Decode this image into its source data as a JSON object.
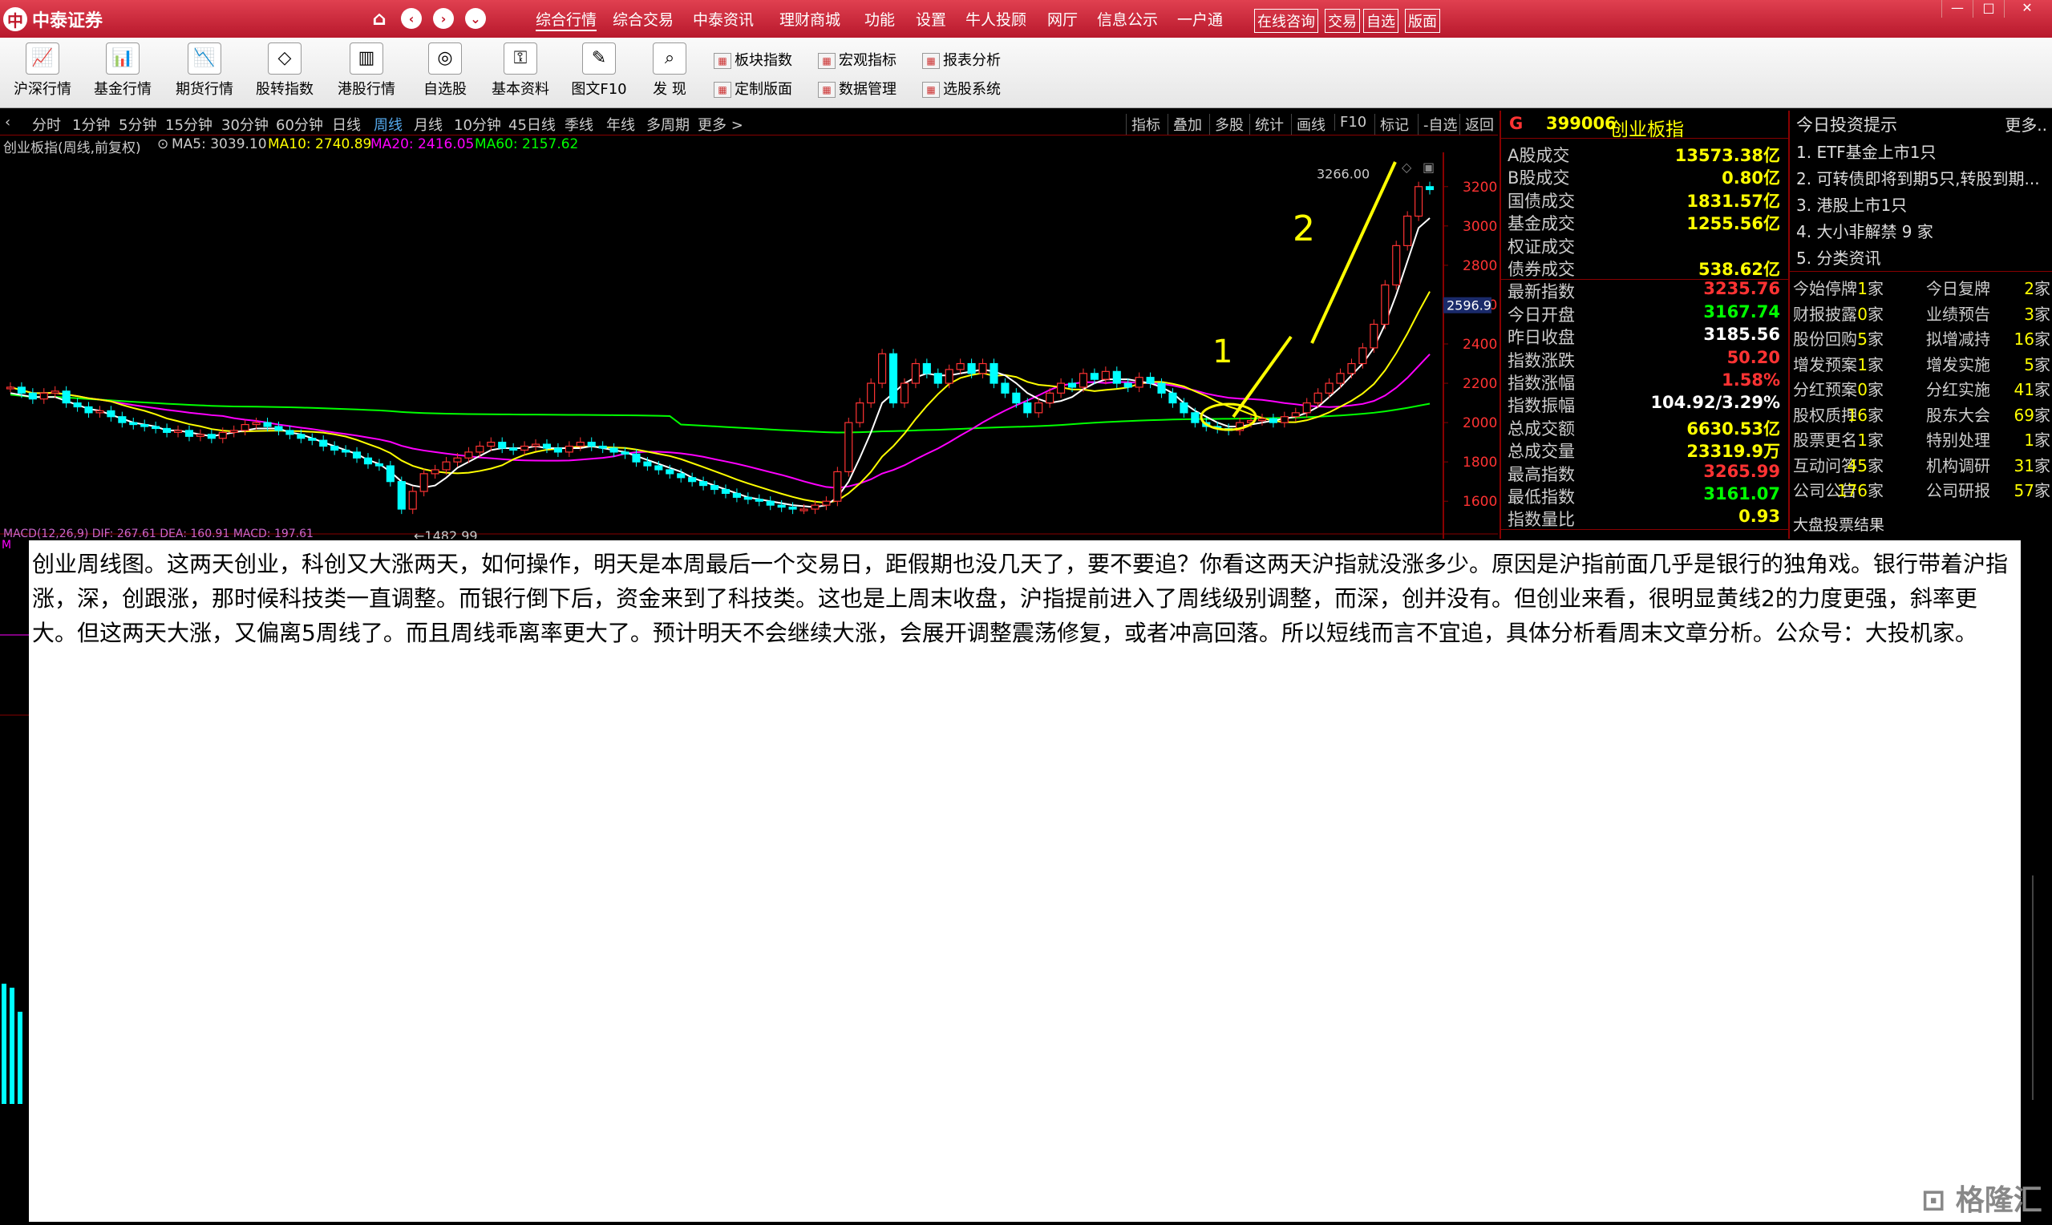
{
  "app": {
    "brand": "中泰证券"
  },
  "menu": {
    "items": [
      "综合行情",
      "综合交易",
      "中泰资讯",
      "理财商城",
      "功能",
      "设置",
      "牛人投顾",
      "网厅",
      "信息公示",
      "一户通"
    ],
    "boxed": [
      "在线咨询",
      "交易",
      "自选",
      "版面"
    ]
  },
  "window_controls": [
    "—",
    "□",
    "✕"
  ],
  "toolbar": {
    "tools": [
      "沪深行情",
      "基金行情",
      "期货行情",
      "股转指数",
      "港股行情",
      "自选股",
      "基本资料",
      "图文F10",
      "发 现"
    ],
    "mini": [
      "板块指数",
      "宏观指标",
      "报表分析",
      "定制版面",
      "数据管理",
      "选股系统"
    ]
  },
  "periods": {
    "items": [
      "分时",
      "1分钟",
      "5分钟",
      "15分钟",
      "30分钟",
      "60分钟",
      "日线",
      "周线",
      "月线",
      "10分钟",
      "45日线",
      "季线",
      "年线",
      "多周期",
      "更多 >"
    ],
    "active": "周线"
  },
  "chart_tools": [
    "指标",
    "叠加",
    "多股",
    "统计",
    "画线",
    "F10",
    "标记",
    "-自选",
    "返回"
  ],
  "chart": {
    "name": "创业板指(周线,前复权)",
    "ma5": "MA5: 3039.10",
    "ma10": "MA10: 2740.89",
    "ma20": "MA20: 2416.05",
    "ma60": "MA60: 2157.62",
    "high_label": "3266.00",
    "low_label": "1482.99",
    "current_marker": "2596.9",
    "handwritten_1": "1",
    "handwritten_2": "2",
    "macd_label": "MACD(12,26,9) DIF: 267.61 DEA: 160.91 MACD: 197.61",
    "colors": {
      "up": "#ff3333",
      "down": "#00ffff",
      "ma5": "#ffffff",
      "ma10": "#ffff00",
      "ma20": "#ff00ff",
      "ma60": "#00ff00",
      "annotation": "#ffff00"
    }
  },
  "chart_data": {
    "type": "candlestick",
    "y_ticks": [
      3200,
      3000,
      2800,
      2600,
      2400,
      2200,
      2000,
      1800,
      1600
    ],
    "ylim": [
      1450,
      3350
    ],
    "annotations": {
      "high": 3266.0,
      "low": 1482.99,
      "current": 2596.9
    },
    "close": [
      2180,
      2150,
      2120,
      2150,
      2160,
      2100,
      2080,
      2050,
      2060,
      2030,
      2000,
      1990,
      1980,
      1970,
      1950,
      1960,
      1930,
      1940,
      1920,
      1950,
      1960,
      1990,
      2000,
      1980,
      1960,
      1940,
      1920,
      1910,
      1880,
      1860,
      1850,
      1820,
      1790,
      1780,
      1700,
      1560,
      1650,
      1740,
      1760,
      1800,
      1820,
      1850,
      1880,
      1900,
      1870,
      1860,
      1880,
      1890,
      1870,
      1850,
      1880,
      1900,
      1880,
      1870,
      1850,
      1840,
      1800,
      1780,
      1760,
      1740,
      1720,
      1700,
      1680,
      1660,
      1640,
      1620,
      1610,
      1600,
      1580,
      1570,
      1560,
      1560,
      1580,
      1600,
      1750,
      2000,
      2100,
      2200,
      2350,
      2100,
      2200,
      2300,
      2250,
      2200,
      2270,
      2300,
      2250,
      2300,
      2200,
      2150,
      2100,
      2050,
      2100,
      2150,
      2200,
      2180,
      2250,
      2220,
      2260,
      2200,
      2180,
      2230,
      2200,
      2150,
      2100,
      2050,
      2000,
      1980,
      1970,
      1960,
      2000,
      2010,
      2020,
      2000,
      2030,
      2050,
      2100,
      2150,
      2200,
      2250,
      2300,
      2380,
      2500,
      2700,
      2900,
      3050,
      3200,
      3185
    ],
    "ma5": [
      2150,
      2140,
      2130,
      2130,
      2130,
      2110,
      2090,
      2070,
      2060,
      2040,
      2020,
      2000,
      1990,
      1980,
      1960,
      1960,
      1950,
      1940,
      1930,
      1940,
      1950,
      1960,
      1970,
      1970,
      1970,
      1950,
      1940,
      1920,
      1900,
      1880,
      1860,
      1840,
      1810,
      1790,
      1750,
      1700,
      1680,
      1670,
      1680,
      1720,
      1770,
      1800,
      1830,
      1860,
      1870,
      1870,
      1870,
      1880,
      1870,
      1870,
      1870,
      1870,
      1880,
      1870,
      1860,
      1850,
      1830,
      1810,
      1790,
      1770,
      1750,
      1720,
      1700,
      1680,
      1660,
      1640,
      1620,
      1610,
      1600,
      1590,
      1580,
      1575,
      1570,
      1580,
      1620,
      1700,
      1820,
      1950,
      2100,
      2150,
      2200,
      2230,
      2250,
      2240,
      2240,
      2250,
      2260,
      2270,
      2260,
      2240,
      2200,
      2150,
      2120,
      2100,
      2110,
      2130,
      2170,
      2200,
      2220,
      2220,
      2220,
      2210,
      2200,
      2180,
      2150,
      2100,
      2060,
      2030,
      2000,
      1980,
      1980,
      1990,
      2000,
      2010,
      2020,
      2030,
      2050,
      2080,
      2130,
      2180,
      2240,
      2300,
      2380,
      2500,
      2650,
      2820,
      2990,
      3040
    ]
  },
  "stock_panel": {
    "flag": "G",
    "code": "399006",
    "name": "创业板指",
    "rows": [
      {
        "label": "A股成交",
        "value": "13573.38亿",
        "color": "#ffff00"
      },
      {
        "label": "B股成交",
        "value": "0.80亿",
        "color": "#ffff00"
      },
      {
        "label": "国债成交",
        "value": "1831.57亿",
        "color": "#ffff00"
      },
      {
        "label": "基金成交",
        "value": "1255.56亿",
        "color": "#ffff00"
      },
      {
        "label": "权证成交",
        "value": "",
        "color": "#ffff00"
      },
      {
        "label": "债券成交",
        "value": "538.62亿",
        "color": "#ffff00"
      },
      {
        "label": "最新指数",
        "value": "3235.76",
        "color": "#ff3333"
      },
      {
        "label": "今日开盘",
        "value": "3167.74",
        "color": "#00ff00"
      },
      {
        "label": "昨日收盘",
        "value": "3185.56",
        "color": "#ffffff"
      },
      {
        "label": "指数涨跌",
        "value": "50.20",
        "color": "#ff3333"
      },
      {
        "label": "指数涨幅",
        "value": "1.58%",
        "color": "#ff3333"
      },
      {
        "label": "指数振幅",
        "value": "104.92/3.29%",
        "color": "#ffffff"
      },
      {
        "label": "总成交额",
        "value": "6630.53亿",
        "color": "#ffff00"
      },
      {
        "label": "总成交量",
        "value": "23319.9万",
        "color": "#ffff00"
      },
      {
        "label": "最高指数",
        "value": "3265.99",
        "color": "#ff3333"
      },
      {
        "label": "最低指数",
        "value": "3161.07",
        "color": "#00ff00"
      },
      {
        "label": "指数量比",
        "value": "0.93",
        "color": "#ffff00"
      }
    ]
  },
  "news_panel": {
    "title": "今日投资提示",
    "more": "更多..",
    "items": [
      "1. ETF基金上市1只",
      "2. 可转债即将到期5只,转股到期...",
      "3. 港股上市1只",
      "4. 大小非解禁 9 家",
      "5. 分类资讯"
    ],
    "stats": [
      [
        "今始停牌",
        "1家",
        "今日复牌",
        "2家"
      ],
      [
        "财报披露",
        "0家",
        "业绩预告",
        "3家"
      ],
      [
        "股份回购",
        "5家",
        "拟增减持",
        "16家"
      ],
      [
        "增发预案",
        "1家",
        "增发实施",
        "5家"
      ],
      [
        "分红预案",
        "0家",
        "分红实施",
        "41家"
      ],
      [
        "股权质押",
        "16家",
        "股东大会",
        "69家"
      ],
      [
        "股票更名",
        "1家",
        "特别处理",
        "1家"
      ],
      [
        "互动问答",
        "45家",
        "机构调研",
        "31家"
      ],
      [
        "公司公告",
        "176家",
        "公司研报",
        "57家"
      ]
    ],
    "vote_title": "大盘投票结果"
  },
  "overlay": {
    "text": "创业周线图。这两天创业，科创又大涨两天，如何操作，明天是本周最后一个交易日，距假期也没几天了，要不要追？你看这两天沪指就没涨多少。原因是沪指前面几乎是银行的独角戏。银行带着沪指涨，深，创跟涨，那时候科技类一直调整。而银行倒下后，资金来到了科技类。这也是上周末收盘，沪指提前进入了周线级别调整，而深，创并没有。但创业来看，很明显黄线2的力度更强，斜率更大。但这两天大涨，又偏离5周线了。而且周线乖离率更大了。预计明天不会继续大涨，会展开调整震荡修复，或者冲高回落。所以短线而言不宜追，具体分析看周末文章分析。公众号：大投机家。"
  },
  "watermark": {
    "text": "格隆汇"
  }
}
